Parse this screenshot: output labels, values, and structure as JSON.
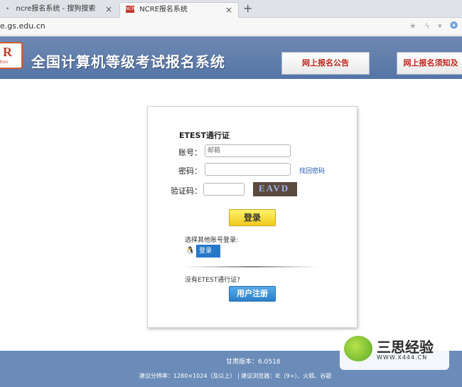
{
  "browser": {
    "tabs": [
      {
        "label": "ncre报名系统 - 搜狗搜索",
        "close": "×"
      },
      {
        "label": "NCRE报名系统",
        "close": "×",
        "favicon": "NCRE"
      }
    ],
    "new_tab": "+",
    "url": "e.gs.edu.cn",
    "icons": [
      "star-icon",
      "bolt-icon",
      "dropdown-icon",
      "paw-icon"
    ]
  },
  "banner": {
    "title": "全国计算机等级考试报名系统",
    "logo_letter": "R",
    "logo_text": "ation",
    "nav": [
      "网上报名公告",
      "网上报名须知及"
    ]
  },
  "login": {
    "title": "ETEST通行证",
    "account_label": "账号：",
    "account_placeholder": "邮箱",
    "password_label": "密码：",
    "forgot": "找回密码",
    "captcha_label": "验证码：",
    "captcha_text": "EAVD",
    "login_button": "登录",
    "other_login_label": "选择其他账号登录:",
    "qq_login": "登录",
    "no_account": "没有ETEST通行证?",
    "register_button": "用户注册"
  },
  "footer": {
    "version": "甘肃版本：6.0518",
    "suggest": "建议分辨率：1280×1024（及以上）  |  建议浏览器：IE（9+）、火狐、谷歌"
  },
  "watermark": {
    "text": "三思经验",
    "url": "WWW.X444.CN"
  }
}
